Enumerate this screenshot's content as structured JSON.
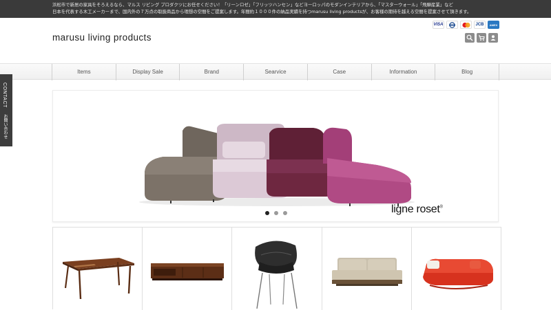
{
  "topbar": {
    "line1": "浜松市で新居の家具をそろえるなら、マルス リビング プロダクツにお任せください！「リーンロゼ」「フリッツハンセン」などヨーロッパのモダンインテリアから、「マスターウォール」「飛騨産業」など",
    "line2": "日本を代表する木工メーカーまで、国内外の７万点の取扱商品から理想の空間をご提案します。年間約１０００件の納品実績を持つmarusu living productsが、お客様の期待を越える空間を提案させて頂きます。"
  },
  "header": {
    "logo": "marusu living products",
    "cards": [
      "VISA",
      "Diners",
      "MasterCard",
      "JCB",
      "AMERICAN EXPRESS"
    ],
    "cards_short": {
      "visa": "VISA",
      "jcb": "JCB",
      "amex": "AMEX"
    },
    "tools": [
      "search-icon",
      "cart-icon",
      "member-icon"
    ]
  },
  "nav": {
    "items": [
      "Items",
      "Display Sale",
      "Brand",
      "Searvice",
      "Case",
      "Information",
      "Blog"
    ]
  },
  "contact_tab": {
    "en": "CONTACT",
    "jp": "お問い合わせ"
  },
  "slider": {
    "brand": "ligne roset",
    "brand_mark": "®",
    "slide_count": 3,
    "active_slide": 1,
    "colors": {
      "taupe": "#7c7268",
      "lilac": "#dcc9d6",
      "plum": "#6e2740",
      "magenta": "#b04a84"
    }
  },
  "products": {
    "items": [
      "wooden-dining-table",
      "walnut-tv-board",
      "black-shell-chair",
      "beige-sofa",
      "red-sofa"
    ]
  },
  "colors": {
    "topbar_bg": "#3a3a3a",
    "contact_bg": "#3d3d3d",
    "nav_text": "#555555"
  }
}
